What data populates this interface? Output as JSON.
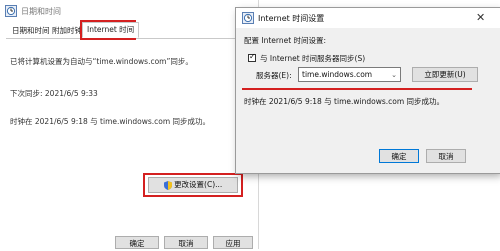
{
  "back_window": {
    "title": "日期和时间",
    "tabs": [
      {
        "label": "日期和时间"
      },
      {
        "label": "附加时钟"
      },
      {
        "label": "Internet 时间"
      }
    ],
    "lines": [
      "已将计算机设置为自动与“time.windows.com”同步。",
      "下次同步: 2021/6/5 9:33",
      "时钟在 2021/6/5 9:18 与 time.windows.com 同步成功。"
    ],
    "change_settings_label": "更改设置(C)...",
    "ok_label": "确定",
    "cancel_label": "取消",
    "apply_label": "应用"
  },
  "dialog": {
    "title": "Internet 时间设置",
    "config_label": "配置 Internet 时间设置:",
    "sync_checkbox_label": "与 Internet 时间服务器同步(S)",
    "sync_checked": true,
    "server_label": "服务器(E):",
    "server_value": "time.windows.com",
    "update_now_label": "立即更新(U)",
    "status_text": "时钟在 2021/6/5 9:18 与 time.windows.com 同步成功。",
    "ok_label": "确定",
    "cancel_label": "取消"
  },
  "colors": {
    "highlight_red": "#d42020",
    "accent_blue": "#0078d7"
  },
  "icons": {
    "window_icon": "clock-icon",
    "shield_icon": "uac-shield-icon",
    "dropdown_icon": "chevron-down-icon",
    "close_icon": "close-icon"
  }
}
